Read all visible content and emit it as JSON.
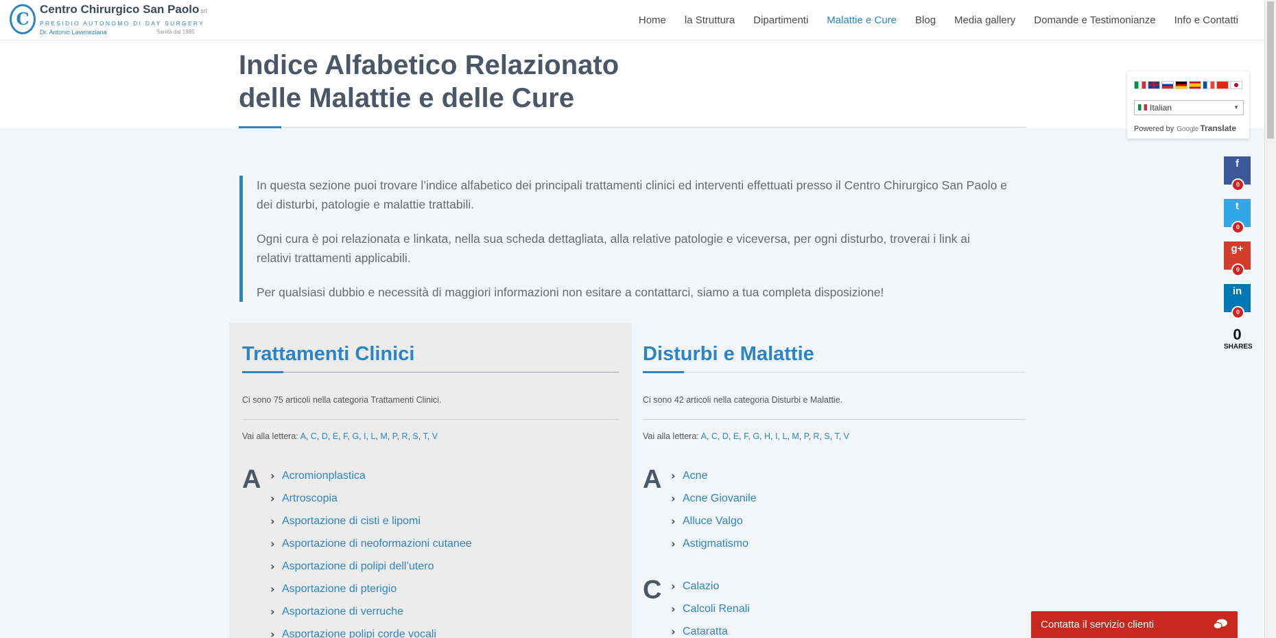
{
  "header": {
    "logo": {
      "title": "Centro Chirurgico San Paolo",
      "suffix": "srl",
      "subtitle": "PRESIDIO AUTONOMO DI DAY SURGERY",
      "doctor": "Dr. Antonio Laveneziana",
      "since": "Sanità dal 1985"
    },
    "nav": [
      {
        "label": "Home",
        "active": false
      },
      {
        "label": "la Struttura",
        "active": false
      },
      {
        "label": "Dipartimenti",
        "active": false
      },
      {
        "label": "Malattie e Cure",
        "active": true
      },
      {
        "label": "Blog",
        "active": false
      },
      {
        "label": "Media gallery",
        "active": false
      },
      {
        "label": "Domande e Testimonianze",
        "active": false
      },
      {
        "label": "Info e Contatti",
        "active": false
      }
    ]
  },
  "page": {
    "title_line1": "Indice Alfabetico Relazionato",
    "title_line2": "delle Malattie e delle Cure",
    "intro": [
      "In questa sezione puoi trovare l’indice alfabetico dei principali trattamenti clinici ed interventi effettuati  presso il Centro Chirurgico San Paolo e dei disturbi, patologie e malattie trattabili.",
      "Ogni cura è poi relazionata e linkata, nella sua scheda dettagliata, alla relative patologie  e viceversa, per ogni disturbo, troverai i link ai relativi trattamenti applicabili.",
      "Per qualsiasi dubbio e necessità di maggiori informazioni non esitare a contattarci, siamo a tua completa disposizione!"
    ]
  },
  "treatments": {
    "title": "Trattamenti Clinici",
    "count_text": "Ci sono 75 articoli nella categoria Trattamenti Clinici.",
    "jump_label": "Vai alla lettera:",
    "letters": [
      "A",
      "C",
      "D",
      "E",
      "F",
      "G",
      "I",
      "L",
      "M",
      "P",
      "R",
      "S",
      "T",
      "V"
    ],
    "groups": [
      {
        "letter": "A",
        "items": [
          "Acromionplastica",
          "Artroscopia",
          "Asportazione di cisti e lipomi",
          "Asportazione di neoformazioni cutanee",
          "Asportazione di polipi dell’utero",
          "Asportazione di pterigio",
          "Asportazione di verruche",
          "Asportazione polipi corde vocali"
        ]
      }
    ]
  },
  "diseases": {
    "title": "Disturbi e Malattie",
    "count_text": "Ci sono 42 articoli nella categoria Disturbi e Malattie.",
    "jump_label": "Vai alla lettera:",
    "letters": [
      "A",
      "C",
      "D",
      "E",
      "F",
      "G",
      "H",
      "I",
      "L",
      "M",
      "P",
      "R",
      "S",
      "T",
      "V"
    ],
    "groups": [
      {
        "letter": "A",
        "items": [
          "Acne",
          "Acne Giovanile",
          "Alluce Valgo",
          "Astigmatismo"
        ]
      },
      {
        "letter": "C",
        "items": [
          "Calazio",
          "Calcoli Renali",
          "Cataratta"
        ]
      }
    ]
  },
  "translate": {
    "selected_language": "Italian",
    "powered_by": "Powered by",
    "google": "Google",
    "translate": "Translate",
    "flags": [
      "flag-it",
      "flag-gb",
      "flag-ru",
      "flag-de",
      "flag-es",
      "flag-fr",
      "flag-cn",
      "flag-jp"
    ]
  },
  "share": {
    "buttons": [
      {
        "network": "facebook",
        "icon": "f",
        "count": "0",
        "color": "#3b5998"
      },
      {
        "network": "twitter",
        "icon": "t",
        "count": "0",
        "color": "#32a8e8"
      },
      {
        "network": "google-plus",
        "icon": "g+",
        "count": "0",
        "color": "#d23e2b"
      },
      {
        "network": "linkedin",
        "icon": "in",
        "count": "0",
        "color": "#0077b5"
      }
    ],
    "total": "0",
    "total_label": "SHARES"
  },
  "chat": {
    "label": "Contatta il servizio clienti"
  },
  "colors": {
    "accent": "#2d84c4",
    "heading": "#4a5766",
    "chat": "#c9281f"
  }
}
